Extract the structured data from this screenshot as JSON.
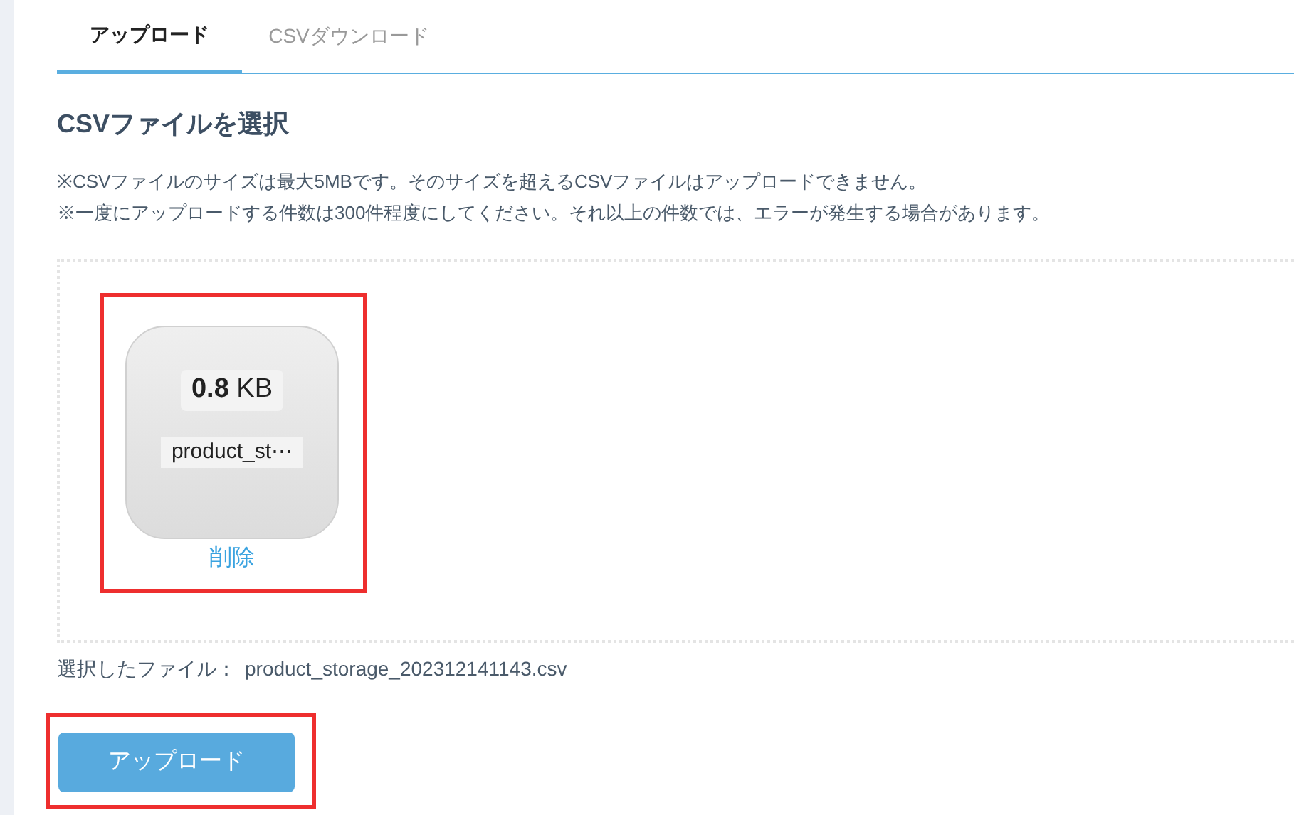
{
  "tabs": [
    {
      "label": "アップロード",
      "selected": true
    },
    {
      "label": "CSVダウンロード",
      "selected": false
    }
  ],
  "heading": "CSVファイルを選択",
  "notes": [
    "※CSVファイルのサイズは最大5MBです。そのサイズを超えるCSVファイルはアップロードできません。",
    "※一度にアップロードする件数は300件程度にしてください。それ以上の件数では、エラーが発生する場合があります。"
  ],
  "file_card": {
    "size_value": "0.8",
    "size_unit": "KB",
    "name": "product_st⋯",
    "remove": "削除",
    "highlighted": true
  },
  "selected_file": {
    "label": "選択したファイル：",
    "value": "product_storage_202312141143.csv"
  },
  "upload_button": {
    "label": "アップロード",
    "highlighted": true
  }
}
